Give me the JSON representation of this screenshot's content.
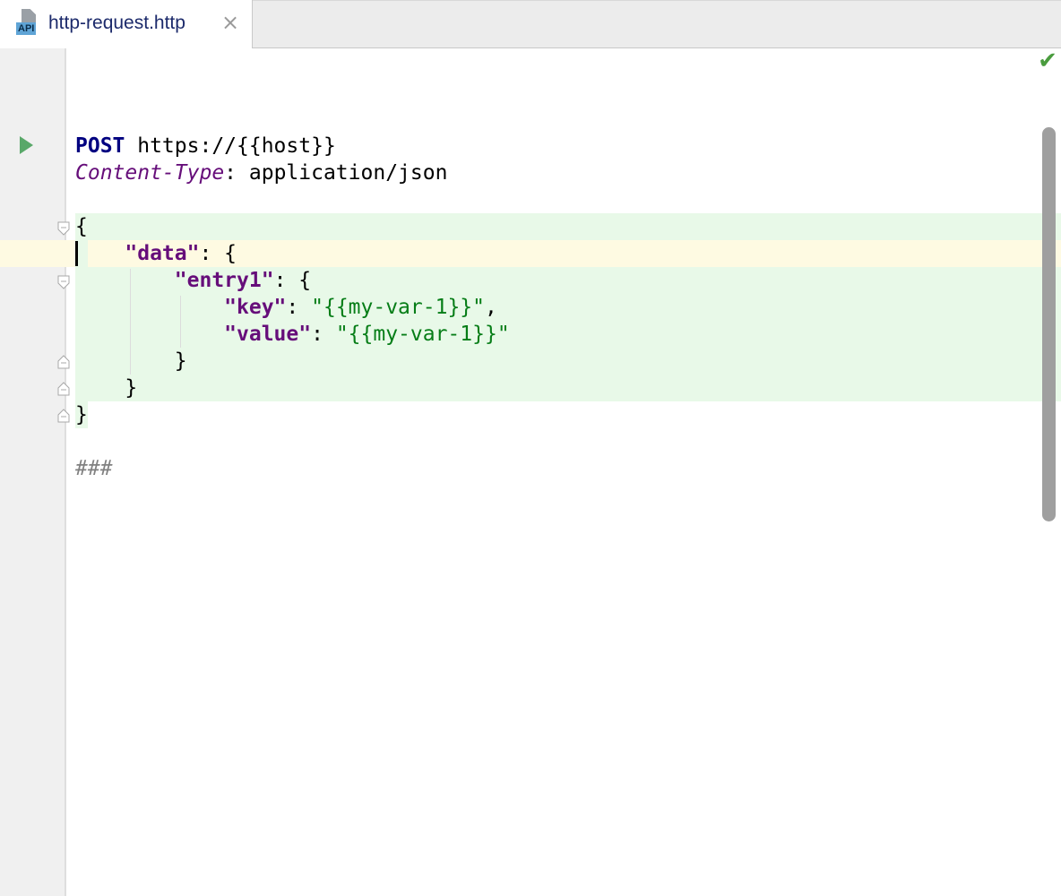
{
  "tab": {
    "icon_badge": "API",
    "title": "http-request.http",
    "close_glyph": "×"
  },
  "icons": {
    "run": "run-request-icon",
    "status": "inspection-ok-icon",
    "fold": "fold-marker-icon",
    "file": "http-api-file-icon"
  },
  "editor": {
    "method": "POST",
    "url": " https://{{host}}",
    "header_name": "Content-Type",
    "header_sep": ": ",
    "header_value": "application/json",
    "body": {
      "l1": "{",
      "l2_indent": "    ",
      "l2_key": "\"data\"",
      "l2_rest": ": {",
      "l3_indent": "        ",
      "l3_key": "\"entry1\"",
      "l3_rest": ": {",
      "l4_indent": "            ",
      "l4_key": "\"key\"",
      "l4_colon": ": ",
      "l4_value": "\"{{my-var-1}}\"",
      "l4_comma": ",",
      "l5_indent": "            ",
      "l5_key": "\"value\"",
      "l5_colon": ": ",
      "l5_value": "\"{{my-var-1}}\"",
      "l6": "        }",
      "l7": "    }",
      "l8": "}"
    },
    "separator": "###"
  },
  "colors": {
    "keyword": "#000080",
    "header_name": "#660e7a",
    "json_key": "#660e7a",
    "string": "#067d17",
    "injected_bg": "#e8f9e8",
    "caret_row_bg": "#fefae2",
    "run_icon": "#59a869",
    "check": "#4a9c3e"
  }
}
